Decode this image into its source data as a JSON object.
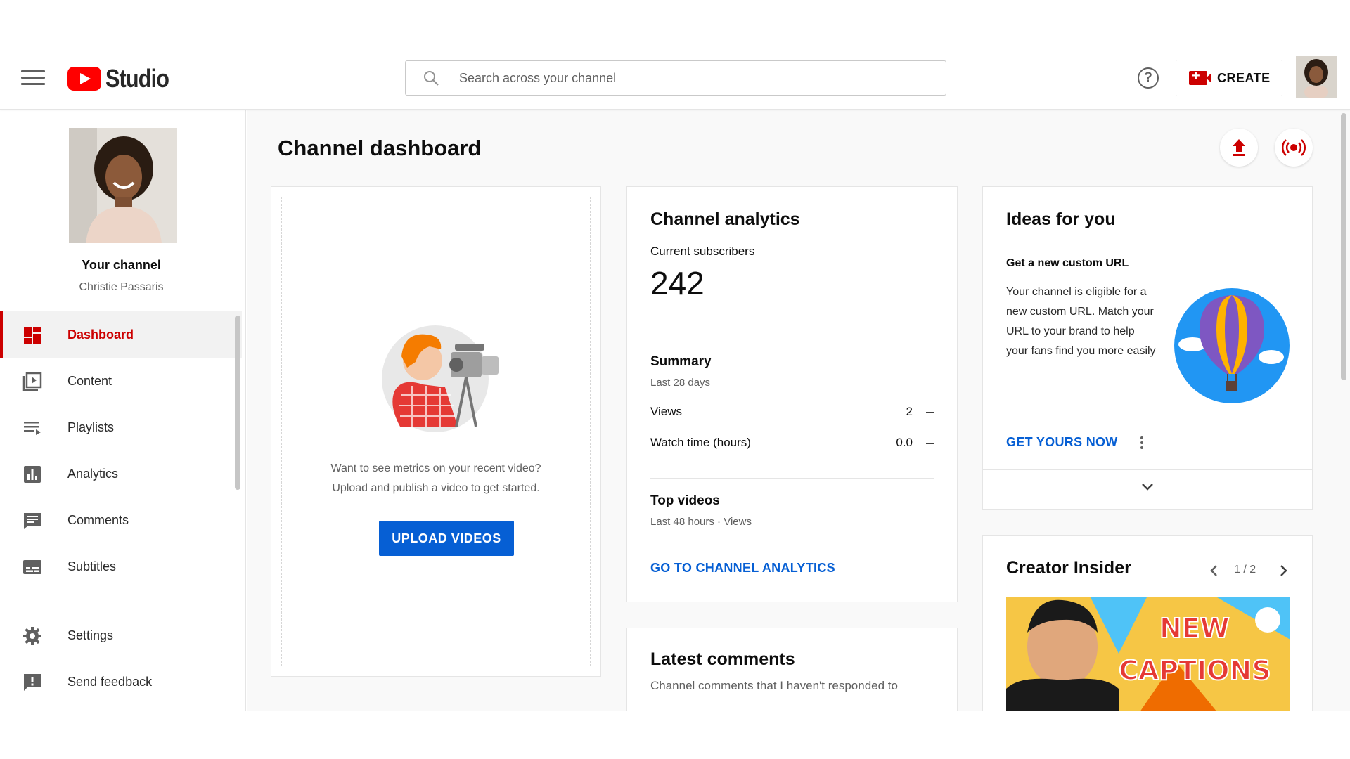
{
  "header": {
    "logo_text": "Studio",
    "search_placeholder": "Search across your channel",
    "help_symbol": "?",
    "create_label": "CREATE"
  },
  "sidebar": {
    "channel_title": "Your channel",
    "channel_name": "Christie Passaris",
    "items": [
      {
        "label": "Dashboard",
        "icon": "dashboard-icon",
        "active": true
      },
      {
        "label": "Content",
        "icon": "content-icon"
      },
      {
        "label": "Playlists",
        "icon": "playlists-icon"
      },
      {
        "label": "Analytics",
        "icon": "analytics-icon"
      },
      {
        "label": "Comments",
        "icon": "comments-icon"
      },
      {
        "label": "Subtitles",
        "icon": "subtitles-icon"
      }
    ],
    "bottom_items": [
      {
        "label": "Settings",
        "icon": "gear-icon"
      },
      {
        "label": "Send feedback",
        "icon": "feedback-icon"
      }
    ]
  },
  "main": {
    "page_title": "Channel dashboard",
    "upload_card": {
      "text_line1": "Want to see metrics on your recent video?",
      "text_line2": "Upload and publish a video to get started.",
      "button_label": "UPLOAD VIDEOS"
    },
    "analytics_card": {
      "title": "Channel analytics",
      "subscribers_label": "Current subscribers",
      "subscribers_value": "242",
      "summary_title": "Summary",
      "summary_period": "Last 28 days",
      "rows": [
        {
          "label": "Views",
          "value": "2"
        },
        {
          "label": "Watch time (hours)",
          "value": "0.0"
        }
      ],
      "top_videos_title": "Top videos",
      "top_videos_period": "Last 48 hours · Views",
      "link_label": "GO TO CHANNEL ANALYTICS"
    },
    "comments_card": {
      "title": "Latest comments",
      "subtitle": "Channel comments that I haven't responded to"
    },
    "ideas_card": {
      "title": "Ideas for you",
      "idea_title": "Get a new custom URL",
      "idea_body": "Your channel is eligible for a new custom URL. Match your URL to your brand to help your fans find you more easily",
      "link_label": "GET YOURS NOW"
    },
    "insider_card": {
      "title": "Creator Insider",
      "pager": "1 / 2",
      "thumb_line1": "NEW",
      "thumb_line2": "CAPTIONS"
    }
  },
  "colors": {
    "brand_red": "#ff0000",
    "active_red": "#cc0000",
    "link_blue": "#065fd4"
  }
}
